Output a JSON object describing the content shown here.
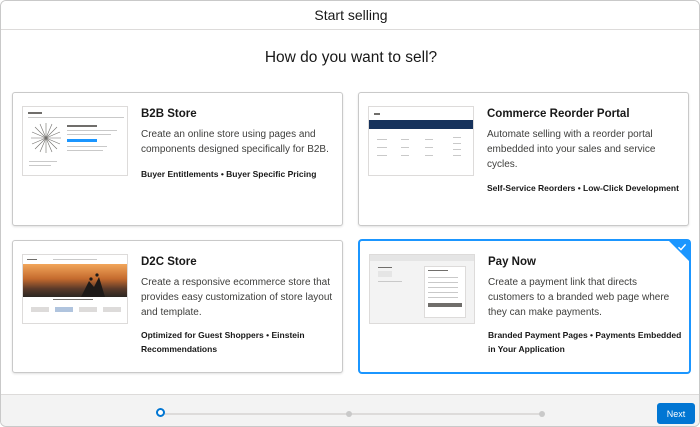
{
  "header": {
    "title": "Start selling"
  },
  "heading": "How do you want to sell?",
  "cards": [
    {
      "title": "B2B Store",
      "description": "Create an online store using pages and components designed specifically for B2B.",
      "tags": "Buyer Entitlements • Buyer Specific Pricing",
      "selected": false
    },
    {
      "title": "Commerce Reorder Portal",
      "description": "Automate selling with a reorder portal embedded into your sales and service cycles.",
      "tags": "Self-Service Reorders • Low-Click Development",
      "selected": false
    },
    {
      "title": "D2C Store",
      "description": "Create a responsive ecommerce store that provides easy customization of store layout and template.",
      "tags": "Optimized for Guest Shoppers • Einstein Recommendations",
      "selected": false
    },
    {
      "title": "Pay Now",
      "description": "Create a payment link that directs customers to a branded web page where they can make payments.",
      "tags": "Branded Payment Pages • Payments Embedded in Your Application",
      "selected": true
    }
  ],
  "footer": {
    "next_label": "Next",
    "progress_step": 1,
    "progress_total": 3
  },
  "colors": {
    "brand": "#0176d3",
    "selected_border": "#1b96ff"
  },
  "icons": {
    "selected": "check-icon"
  }
}
